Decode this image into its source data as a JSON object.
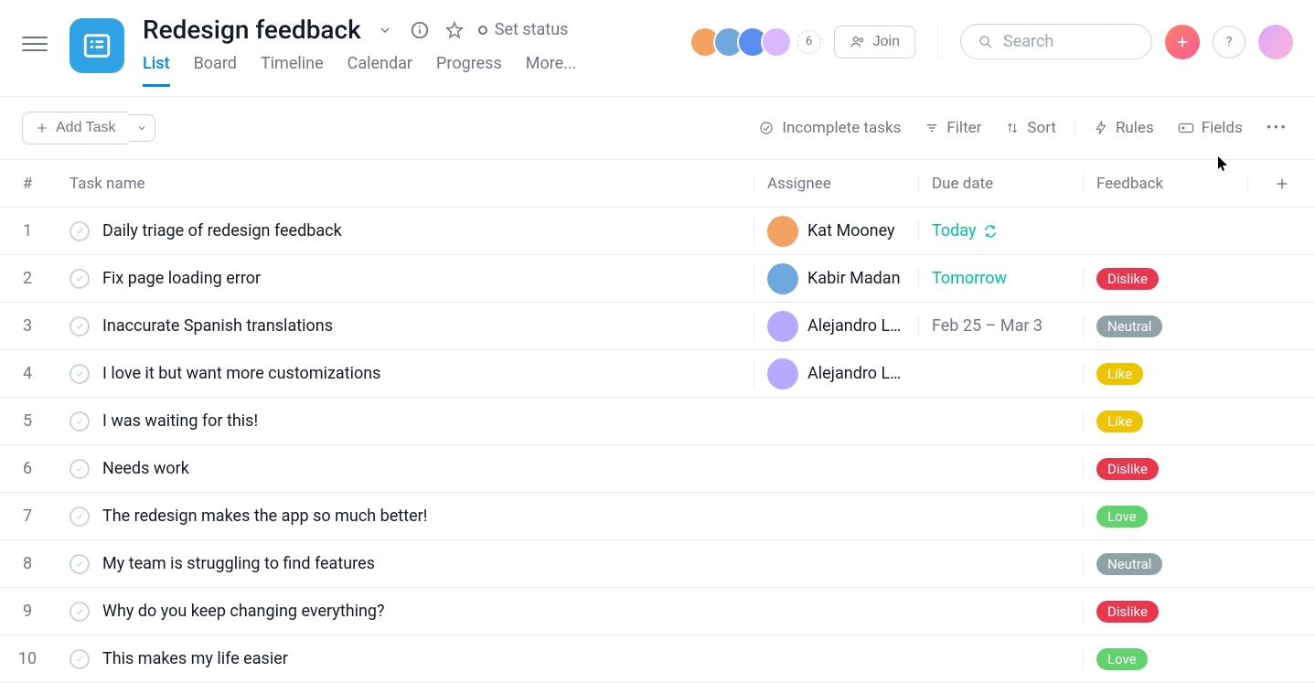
{
  "header": {
    "project_title": "Redesign feedback",
    "set_status_label": "Set status",
    "member_count": "6",
    "join_label": "Join",
    "search_placeholder": "Search",
    "help_label": "?",
    "tabs": [
      {
        "label": "List",
        "active": true
      },
      {
        "label": "Board",
        "active": false
      },
      {
        "label": "Timeline",
        "active": false
      },
      {
        "label": "Calendar",
        "active": false
      },
      {
        "label": "Progress",
        "active": false
      },
      {
        "label": "More...",
        "active": false
      }
    ],
    "avatars": [
      {
        "bg": "#f4a261"
      },
      {
        "bg": "#6fa8dc"
      },
      {
        "bg": "#5b8def"
      },
      {
        "bg": "#d9b8ff"
      }
    ]
  },
  "toolbar": {
    "add_task_label": "Add Task",
    "filter_completion": "Incomplete tasks",
    "filter_label": "Filter",
    "sort_label": "Sort",
    "rules_label": "Rules",
    "fields_label": "Fields"
  },
  "table": {
    "columns": {
      "num": "#",
      "name": "Task name",
      "assignee": "Assignee",
      "due": "Due date",
      "feedback": "Feedback"
    },
    "rows": [
      {
        "num": "1",
        "name": "Daily triage of redesign feedback",
        "assignee": {
          "name": "Kat Mooney",
          "bg": "#f4a261",
          "truncated": false
        },
        "due": {
          "text": "Today",
          "cls": "due-today",
          "repeat": true
        },
        "feedback": null
      },
      {
        "num": "2",
        "name": "Fix page loading error",
        "assignee": {
          "name": "Kabir Madan",
          "bg": "#6fa8dc",
          "truncated": false
        },
        "due": {
          "text": "Tomorrow",
          "cls": "due-tomorrow",
          "repeat": false
        },
        "feedback": {
          "text": "Dislike",
          "cls": "pill-dislike"
        }
      },
      {
        "num": "3",
        "name": "Inaccurate Spanish translations",
        "assignee": {
          "name": "Alejandro L…",
          "bg": "#b8a8ff",
          "truncated": true
        },
        "due": {
          "text": "Feb 25 – Mar 3",
          "cls": "due-range",
          "repeat": false
        },
        "feedback": {
          "text": "Neutral",
          "cls": "pill-neutral"
        }
      },
      {
        "num": "4",
        "name": "I love it but want more customizations",
        "assignee": {
          "name": "Alejandro L…",
          "bg": "#b8a8ff",
          "truncated": true
        },
        "due": null,
        "feedback": {
          "text": "Like",
          "cls": "pill-like"
        }
      },
      {
        "num": "5",
        "name": "I was waiting for this!",
        "assignee": null,
        "due": null,
        "feedback": {
          "text": "Like",
          "cls": "pill-like"
        }
      },
      {
        "num": "6",
        "name": "Needs work",
        "assignee": null,
        "due": null,
        "feedback": {
          "text": "Dislike",
          "cls": "pill-dislike"
        }
      },
      {
        "num": "7",
        "name": "The redesign makes the app so much better!",
        "assignee": null,
        "due": null,
        "feedback": {
          "text": "Love",
          "cls": "pill-love"
        }
      },
      {
        "num": "8",
        "name": "My team is struggling to find features",
        "assignee": null,
        "due": null,
        "feedback": {
          "text": "Neutral",
          "cls": "pill-neutral"
        }
      },
      {
        "num": "9",
        "name": "Why do you keep changing everything?",
        "assignee": null,
        "due": null,
        "feedback": {
          "text": "Dislike",
          "cls": "pill-dislike"
        }
      },
      {
        "num": "10",
        "name": "This makes my life easier",
        "assignee": null,
        "due": null,
        "feedback": {
          "text": "Love",
          "cls": "pill-love"
        }
      }
    ]
  }
}
